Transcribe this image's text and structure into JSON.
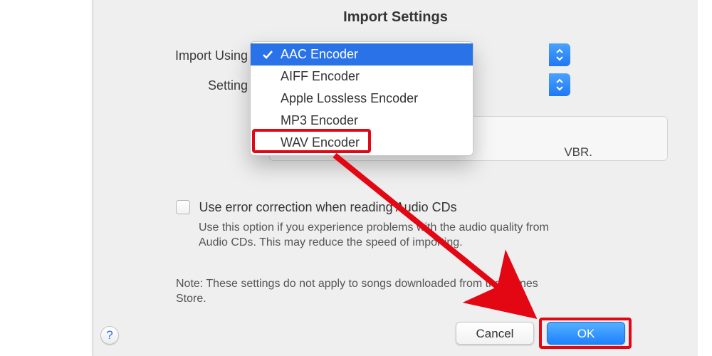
{
  "title": "Import Settings",
  "labels": {
    "import_using": "Import Using",
    "setting": "Setting"
  },
  "encoder_options": [
    "AAC Encoder",
    "AIFF Encoder",
    "Apple Lossless Encoder",
    "MP3 Encoder",
    "WAV Encoder"
  ],
  "selected_encoder_index": 0,
  "details_trailing_text": "VBR.",
  "error_correction": {
    "label": "Use error correction when reading Audio CDs",
    "description": "Use this option if you experience problems with the audio quality from Audio CDs. This may reduce the speed of importing.",
    "checked": false
  },
  "note": "Note: These settings do not apply to songs downloaded from the iTunes Store.",
  "buttons": {
    "cancel": "Cancel",
    "ok": "OK"
  },
  "help_glyph": "?",
  "annotations": {
    "highlighted_option_index": 4,
    "highlighted_button": "ok"
  },
  "colors": {
    "accent": "#2a72e8",
    "annotation": "#e30613"
  }
}
